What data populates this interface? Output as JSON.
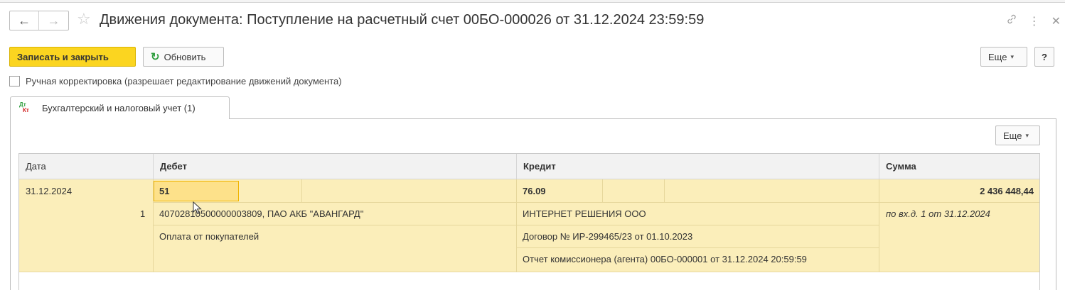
{
  "window": {
    "title": "Движения документа: Поступление на расчетный счет 00БО-000026 от 31.12.2024 23:59:59",
    "back_icon": "arrow-left-icon",
    "forward_icon": "arrow-right-icon",
    "favorite_icon": "star-icon",
    "link_icon": "link-icon",
    "more_icon": "more-vertical-icon",
    "close_icon": "close-icon"
  },
  "toolbar": {
    "save_close_label": "Записать и закрыть",
    "refresh_label": "Обновить",
    "more_label": "Еще",
    "help_label": "?"
  },
  "manual_edit": {
    "label": "Ручная корректировка (разрешает редактирование движений документа)",
    "checked": false
  },
  "tab": {
    "label": "Бухгалтерский и налоговый учет (1)",
    "icon_top": "Дт",
    "icon_bottom": "Кт"
  },
  "table_toolbar": {
    "more_label": "Еще"
  },
  "table": {
    "headers": {
      "date": "Дата",
      "debit": "Дебет",
      "credit": "Кредит",
      "sum": "Сумма"
    },
    "row": {
      "date": "31.12.2024",
      "line_no": "1",
      "debit_account": "51",
      "debit_subconto1": "40702810500000003809, ПАО АКБ \"АВАНГАРД\"",
      "debit_subconto2": "Оплата от покупателей",
      "credit_account": "76.09",
      "credit_subconto1": "ИНТЕРНЕТ РЕШЕНИЯ ООО",
      "credit_subconto2": "Договор № ИР-299465/23 от 01.10.2023",
      "credit_subconto3": "Отчет комиссионера (агента) 00БО-000001 от 31.12.2024 20:59:59",
      "sum": "2 436 448,44",
      "sum_note": "по вх.д. 1 от 31.12.2024"
    }
  },
  "colors": {
    "primary_button": "#fbd520",
    "row_highlight": "#fbeeba",
    "selected_cell": "#fde18a",
    "refresh_icon": "#2e9e3e"
  }
}
